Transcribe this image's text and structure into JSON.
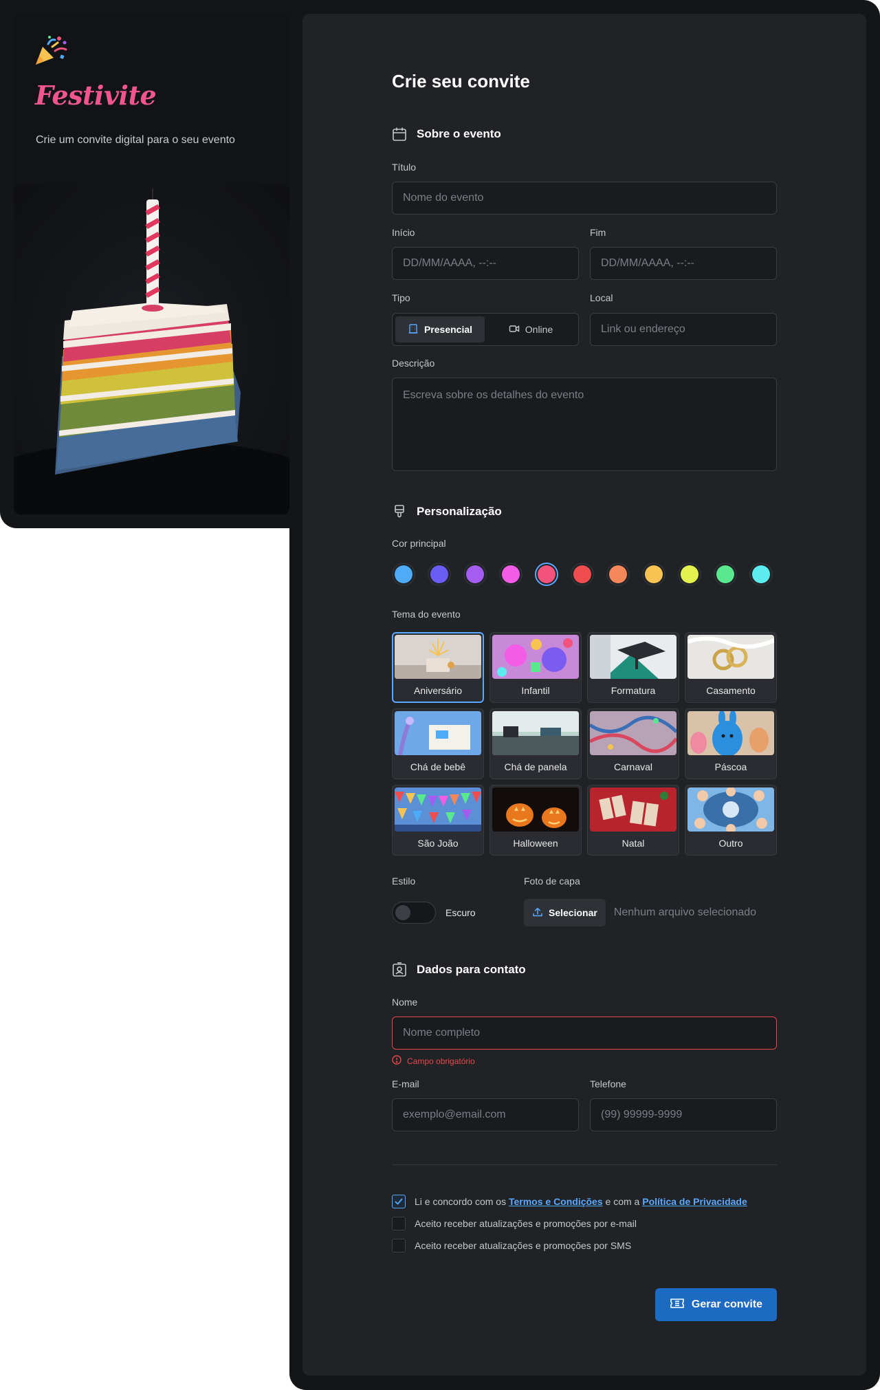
{
  "brand": {
    "name": "Festivite",
    "tagline": "Crie um convite digital para o seu evento"
  },
  "form": {
    "title": "Crie seu convite",
    "section_event": {
      "heading": "Sobre o evento",
      "title_label": "Título",
      "title_placeholder": "Nome do evento",
      "start_label": "Início",
      "start_placeholder": "DD/MM/AAAA, --:--",
      "end_label": "Fim",
      "end_placeholder": "DD/MM/AAAA, --:--",
      "type_label": "Tipo",
      "type_options": [
        "Presencial",
        "Online"
      ],
      "type_selected": "Presencial",
      "location_label": "Local",
      "location_placeholder": "Link ou endereço",
      "description_label": "Descrição",
      "description_placeholder": "Escreva sobre os detalhes do evento"
    },
    "section_custom": {
      "heading": "Personalização",
      "color_label": "Cor principal",
      "colors": [
        "#4dabf7",
        "#6a5cf5",
        "#a55cf0",
        "#f25ce6",
        "#f1537d",
        "#f04e4e",
        "#f5875a",
        "#f7c454",
        "#e3f24e",
        "#59e88d",
        "#5cecf0"
      ],
      "selected_color": "#f1537d",
      "theme_label": "Tema do evento",
      "themes": [
        "Aniversário",
        "Infantil",
        "Formatura",
        "Casamento",
        "Chá de bebê",
        "Chá de panela",
        "Carnaval",
        "Páscoa",
        "São João",
        "Halloween",
        "Natal",
        "Outro"
      ],
      "selected_theme": "Aniversário",
      "style_label": "Estilo",
      "style_value": "Escuro",
      "cover_label": "Foto de capa",
      "cover_button": "Selecionar",
      "cover_status": "Nenhum arquivo selecionado"
    },
    "section_contact": {
      "heading": "Dados para contato",
      "name_label": "Nome",
      "name_placeholder": "Nome completo",
      "name_error": "Campo obrigatório",
      "email_label": "E-mail",
      "email_placeholder": "exemplo@email.com",
      "phone_label": "Telefone",
      "phone_placeholder": "(99) 99999-9999"
    },
    "consent": {
      "terms_prefix": "Li e concordo com os",
      "terms_link": "Termos e Condições",
      "terms_middle": "e com a",
      "privacy_link": "Política de Privacidade",
      "terms_checked": true,
      "email_opt": "Aceito receber atualizações e promoções por e-mail",
      "email_checked": false,
      "sms_opt": "Aceito receber atualizações e promoções por SMS",
      "sms_checked": false
    },
    "submit_label": "Gerar convite"
  }
}
